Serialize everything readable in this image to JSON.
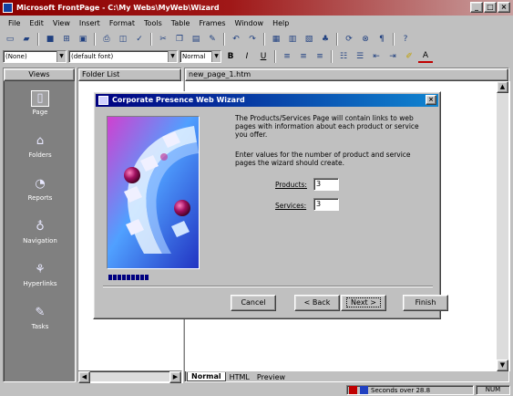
{
  "app": {
    "title": "Microsoft FrontPage - C:\\My Webs\\MyWeb\\Wizard",
    "window_buttons": [
      "_",
      "□",
      "×"
    ]
  },
  "menu": [
    "File",
    "Edit",
    "View",
    "Insert",
    "Format",
    "Tools",
    "Table",
    "Frames",
    "Window",
    "Help"
  ],
  "formatting": {
    "style": "(None)",
    "font": "(default font)",
    "size": "Normal"
  },
  "views": {
    "header": "Views",
    "items": [
      {
        "label": "Page",
        "icon": "page-icon"
      },
      {
        "label": "Folders",
        "icon": "folders-icon"
      },
      {
        "label": "Reports",
        "icon": "reports-icon"
      },
      {
        "label": "Navigation",
        "icon": "navigation-icon"
      },
      {
        "label": "Hyperlinks",
        "icon": "hyperlinks-icon"
      },
      {
        "label": "Tasks",
        "icon": "tasks-icon"
      }
    ]
  },
  "folder_list": {
    "header": "Folder List"
  },
  "editor": {
    "header": "new_page_1.htm",
    "tabs": [
      "Normal",
      "HTML",
      "Preview"
    ]
  },
  "wizard": {
    "title": "Corporate Presence Web Wizard",
    "description": "The Products/Services Page will contain links to web pages with information about each product or service you offer.",
    "instruction": "Enter values for the number of product and service pages the wizard should create.",
    "products_label": "Products:",
    "products_value": "3",
    "services_label": "Services:",
    "services_value": "3",
    "progress_steps_done": 9,
    "buttons": {
      "cancel": "Cancel",
      "back": "< Back",
      "next": "Next >",
      "finish": "Finish"
    }
  },
  "status": {
    "download": "Seconds over 28.8",
    "mode": "NUM"
  },
  "colors": {
    "title_active": "#8b0000",
    "dialog_title": "#000080",
    "views_bg": "#808080",
    "face": "#c0c0c0"
  }
}
